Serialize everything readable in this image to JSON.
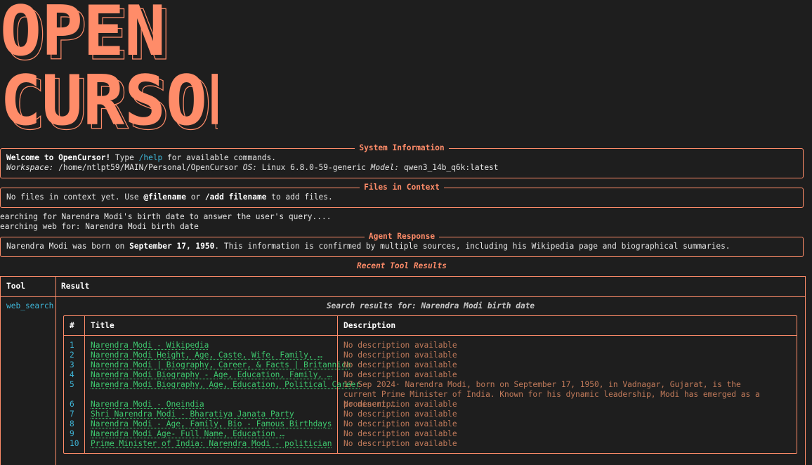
{
  "logo": {
    "lines": [
      "OPEN",
      "CURSOR"
    ]
  },
  "system_info": {
    "title": "System Information",
    "welcome_prefix": "Welcome to OpenCursor!",
    "type_word": " Type ",
    "help_cmd": "/help",
    "help_suffix": " for available commands.",
    "workspace_label": "Workspace:",
    "workspace_value": " /home/ntlpt59/MAIN/Personal/OpenCursor ",
    "os_label": "OS:",
    "os_value": " Linux 6.8.0-59-generic ",
    "model_label": "Model:",
    "model_value": " qwen3_14b_q6k:latest"
  },
  "files_context": {
    "title": "Files in Context",
    "text_prefix": "No files in context yet. Use ",
    "at_filename": "@filename",
    "or_word": " or ",
    "add_filename": "/add filename",
    "text_suffix": " to add files."
  },
  "log": [
    "earching for Narendra Modi's birth date to answer the user's query....",
    "earching web for: Narendra Modi birth date"
  ],
  "agent_response": {
    "title": "Agent Response",
    "prefix": "Narendra Modi was born on ",
    "bold": "September 17, 1950",
    "suffix": ". This information is confirmed by multiple sources, including his Wikipedia page and biographical summaries."
  },
  "recent_tools": {
    "caption": "Recent Tool Results",
    "col_tool": "Tool",
    "col_result": "Result",
    "tool_name": "web_search",
    "search_caption": "Search results for: Narendra Modi birth date",
    "inner_cols": {
      "num": "#",
      "title": "Title",
      "desc": "Description"
    },
    "rows": [
      {
        "num": "1",
        "title": "Narendra Modi - Wikipedia",
        "desc": "No description available"
      },
      {
        "num": "2",
        "title": "Narendra Modi Height, Age, Caste, Wife, Family, …",
        "desc": "No description available"
      },
      {
        "num": "3",
        "title": "Narendra Modi | Biography, Career, & Facts | Britannica",
        "desc": "No description available"
      },
      {
        "num": "4",
        "title": "Narendra Modi Biography - Age, Education, Family, …",
        "desc": "No description available"
      },
      {
        "num": "5",
        "title": "Narendra Modi Biography, Age, Education, Political Career",
        "desc": "17 Sep 2024· Narendra Modi, born on September 17, 1950, in Vadnagar, Gujarat, is the current Prime Minister of India. Known for his dynamic leadership, Modi has emerged as a prominent …"
      },
      {
        "num": "6",
        "title": "Narendra Modi - Oneindia",
        "desc": "No description available"
      },
      {
        "num": "7",
        "title": "Shri Narendra Modi - Bharatiya Janata Party",
        "desc": "No description available"
      },
      {
        "num": "8",
        "title": "Narendra Modi - Age, Family, Bio - Famous Birthdays",
        "desc": "No description available"
      },
      {
        "num": "9",
        "title": "Narendra Modi Age- Full Name, Education …",
        "desc": "No description available"
      },
      {
        "num": "10",
        "title": "Prime Minister of India: Narendra Modi - politician",
        "desc": "No description available"
      }
    ]
  },
  "colors": {
    "accent": "#ff8c69",
    "link": "#3ec96f",
    "cmd": "#3fb6d8",
    "bg": "#1e1e1e"
  }
}
